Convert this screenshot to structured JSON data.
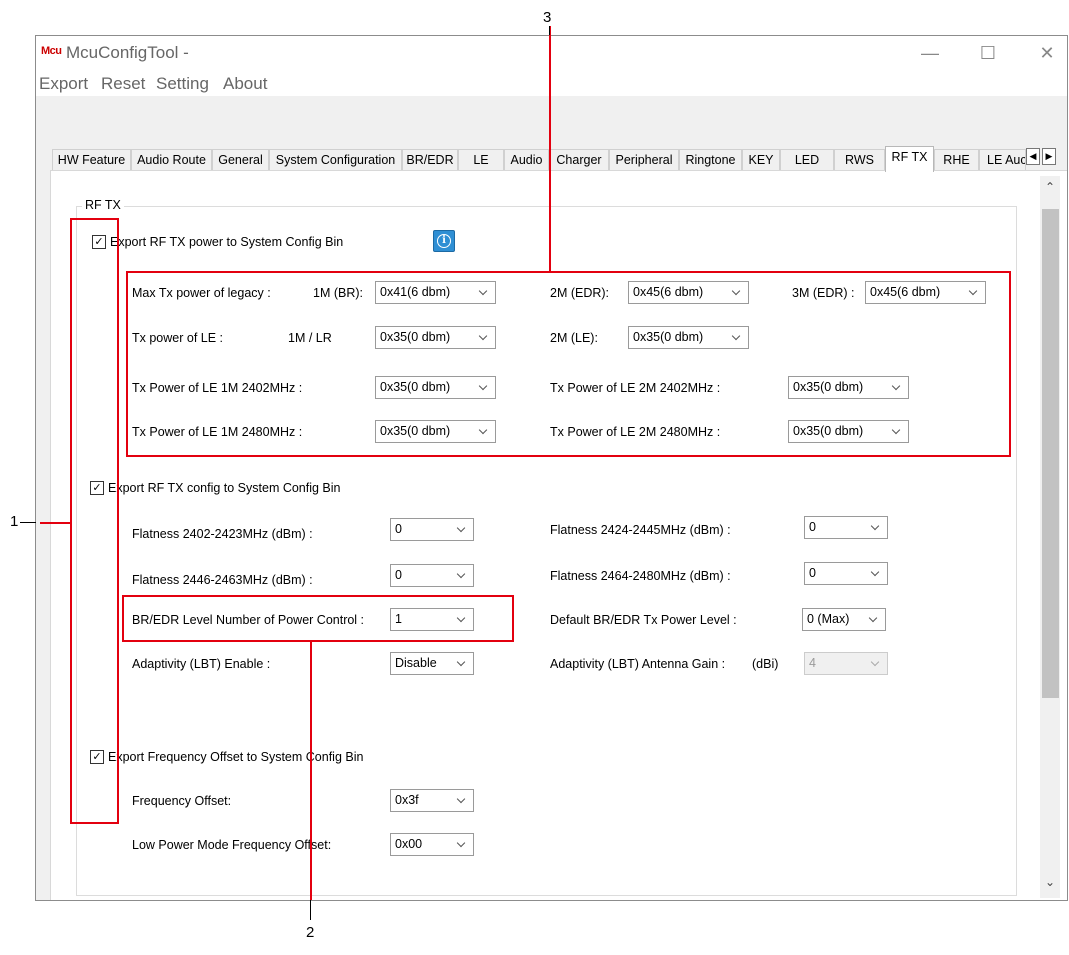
{
  "window": {
    "logo": "Mcu",
    "title": "McuConfigTool -",
    "controls": {
      "minimize": "—",
      "maximize": "☐",
      "close": "✕"
    }
  },
  "menu": [
    "Export",
    "Reset",
    "Setting",
    "About"
  ],
  "tabs": [
    "HW Feature",
    "Audio Route",
    "General",
    "System Configuration",
    "BR/EDR",
    "LE",
    "Audio",
    "Charger",
    "Peripheral",
    "Ringtone",
    "KEY",
    "LED",
    "RWS",
    "RF TX",
    "RHE",
    "LE Auc"
  ],
  "active_tab": "RF TX",
  "tab_scroll": {
    "left": "◀",
    "right": "▶"
  },
  "scroll": {
    "up": "⌃",
    "down": "⌄"
  },
  "group_title": "RF TX",
  "section_power": {
    "checkbox_label": "Export RF TX power to System Config Bin",
    "checked": true,
    "check_glyph": "✓",
    "legacy": {
      "label": "Max Tx power of legacy :",
      "br_label": "1M (BR):",
      "br_value": "0x41(6 dbm)",
      "edr2_label": "2M (EDR):",
      "edr2_value": "0x45(6 dbm)",
      "edr3_label": "3M (EDR) :",
      "edr3_value": "0x45(6 dbm)"
    },
    "le": {
      "label": "Tx power of LE :",
      "lr_label": "1M / LR",
      "lr_value": "0x35(0 dbm)",
      "le2_label": "2M (LE):",
      "le2_value": "0x35(0 dbm)"
    },
    "le1m_2402": {
      "label": "Tx Power of LE 1M 2402MHz :",
      "value": "0x35(0 dbm)"
    },
    "le2m_2402": {
      "label": "Tx Power of LE 2M 2402MHz :",
      "value": "0x35(0 dbm)"
    },
    "le1m_2480": {
      "label": "Tx Power of LE 1M 2480MHz :",
      "value": "0x35(0 dbm)"
    },
    "le2m_2480": {
      "label": "Tx Power of LE 2M 2480MHz :",
      "value": "0x35(0 dbm)"
    }
  },
  "section_config": {
    "checkbox_label": "Export RF TX config to System Config Bin",
    "checked": true,
    "check_glyph": "✓",
    "flat_2402": {
      "label": "Flatness 2402-2423MHz (dBm) :",
      "value": "0"
    },
    "flat_2424": {
      "label": "Flatness 2424-2445MHz (dBm) :",
      "value": "0"
    },
    "flat_2446": {
      "label": "Flatness 2446-2463MHz (dBm) :",
      "value": "0"
    },
    "flat_2464": {
      "label": "Flatness 2464-2480MHz (dBm) :",
      "value": "0"
    },
    "level_num": {
      "label": "BR/EDR Level Number of Power Control :",
      "value": "1"
    },
    "default_level": {
      "label": "Default BR/EDR Tx Power Level :",
      "value": "0 (Max)"
    },
    "lbt_enable": {
      "label": "Adaptivity (LBT) Enable :",
      "value": "Disable"
    },
    "lbt_gain": {
      "label": "Adaptivity (LBT) Antenna Gain :",
      "unit": "(dBi)",
      "value": "4"
    }
  },
  "section_freq": {
    "checkbox_label": "Export Frequency Offset to System Config Bin",
    "checked": true,
    "check_glyph": "✓",
    "offset": {
      "label": "Frequency Offset:",
      "value": "0x3f"
    },
    "low_power": {
      "label": "Low Power Mode Frequency Offset:",
      "value": "0x00"
    }
  },
  "callouts": [
    "1",
    "2",
    "3"
  ]
}
